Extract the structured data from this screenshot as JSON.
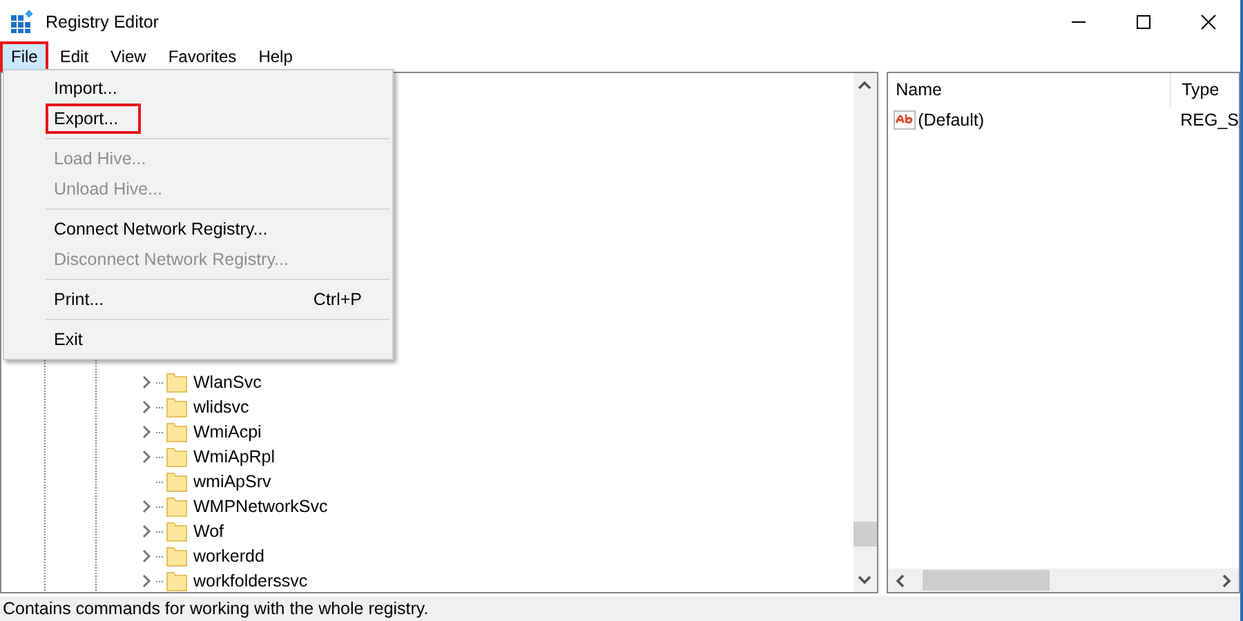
{
  "window": {
    "title": "Registry Editor"
  },
  "menu_bar": [
    {
      "label": "File",
      "selected": true,
      "highlighted": true
    },
    {
      "label": "Edit",
      "selected": false,
      "highlighted": false
    },
    {
      "label": "View",
      "selected": false,
      "highlighted": false
    },
    {
      "label": "Favorites",
      "selected": false,
      "highlighted": false
    },
    {
      "label": "Help",
      "selected": false,
      "highlighted": false
    }
  ],
  "file_menu": [
    {
      "kind": "item",
      "label": "Import...",
      "disabled": false,
      "highlighted": false
    },
    {
      "kind": "item",
      "label": "Export...",
      "disabled": false,
      "highlighted": true
    },
    {
      "kind": "separator"
    },
    {
      "kind": "item",
      "label": "Load Hive...",
      "disabled": true,
      "highlighted": false
    },
    {
      "kind": "item",
      "label": "Unload Hive...",
      "disabled": true,
      "highlighted": false
    },
    {
      "kind": "separator"
    },
    {
      "kind": "item",
      "label": "Connect Network Registry...",
      "disabled": false,
      "highlighted": false
    },
    {
      "kind": "item",
      "label": "Disconnect Network Registry...",
      "disabled": true,
      "highlighted": false
    },
    {
      "kind": "separator"
    },
    {
      "kind": "item",
      "label": "Print...",
      "shortcut": "Ctrl+P",
      "disabled": false,
      "highlighted": false
    },
    {
      "kind": "separator"
    },
    {
      "kind": "item",
      "label": "Exit",
      "disabled": false,
      "highlighted": false
    }
  ],
  "tree": {
    "items": [
      {
        "label": "WlanSvc",
        "expandable": true
      },
      {
        "label": "wlidsvc",
        "expandable": true
      },
      {
        "label": "WmiAcpi",
        "expandable": true
      },
      {
        "label": "WmiApRpl",
        "expandable": true
      },
      {
        "label": "wmiApSrv",
        "expandable": false
      },
      {
        "label": "WMPNetworkSvc",
        "expandable": true
      },
      {
        "label": "Wof",
        "expandable": true
      },
      {
        "label": "workerdd",
        "expandable": true
      },
      {
        "label": "workfolderssvc",
        "expandable": true
      }
    ]
  },
  "values": {
    "columns": [
      "Name",
      "Type"
    ],
    "rows": [
      {
        "name": "(Default)",
        "type": "REG_S"
      }
    ]
  },
  "status_bar": "Contains commands for working with the whole registry."
}
